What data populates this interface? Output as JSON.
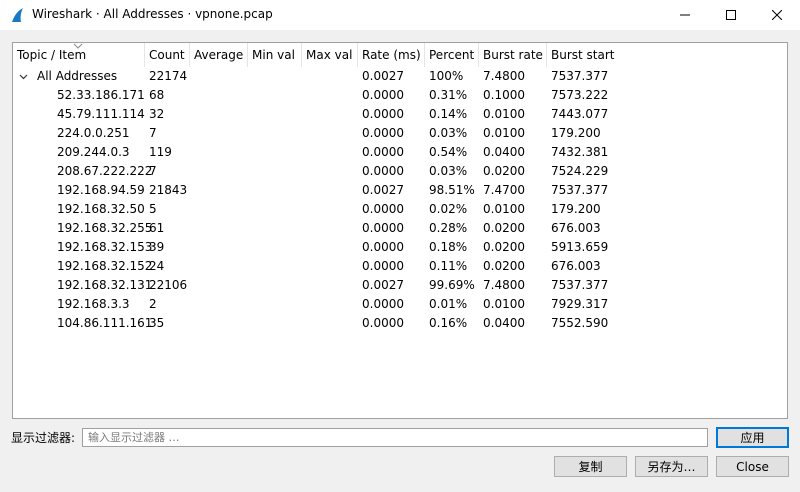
{
  "window": {
    "title": "Wireshark · All Addresses · vpnone.pcap"
  },
  "table": {
    "columns": [
      "Topic / Item",
      "Count",
      "Average",
      "Min val",
      "Max val",
      "Rate (ms)",
      "Percent",
      "Burst rate",
      "Burst start"
    ],
    "rows": [
      {
        "item": "All Addresses",
        "count": "22174",
        "average": "",
        "min": "",
        "max": "",
        "rate": "0.0027",
        "percent": "100%",
        "burst_rate": "7.4800",
        "burst_start": "7537.377",
        "expanded": true
      },
      {
        "item": "52.33.186.171",
        "count": "68",
        "average": "",
        "min": "",
        "max": "",
        "rate": "0.0000",
        "percent": "0.31%",
        "burst_rate": "0.1000",
        "burst_start": "7573.222"
      },
      {
        "item": "45.79.111.114",
        "count": "32",
        "average": "",
        "min": "",
        "max": "",
        "rate": "0.0000",
        "percent": "0.14%",
        "burst_rate": "0.0100",
        "burst_start": "7443.077"
      },
      {
        "item": "224.0.0.251",
        "count": "7",
        "average": "",
        "min": "",
        "max": "",
        "rate": "0.0000",
        "percent": "0.03%",
        "burst_rate": "0.0100",
        "burst_start": "179.200"
      },
      {
        "item": "209.244.0.3",
        "count": "119",
        "average": "",
        "min": "",
        "max": "",
        "rate": "0.0000",
        "percent": "0.54%",
        "burst_rate": "0.0400",
        "burst_start": "7432.381"
      },
      {
        "item": "208.67.222.222",
        "count": "7",
        "average": "",
        "min": "",
        "max": "",
        "rate": "0.0000",
        "percent": "0.03%",
        "burst_rate": "0.0200",
        "burst_start": "7524.229"
      },
      {
        "item": "192.168.94.59",
        "count": "21843",
        "average": "",
        "min": "",
        "max": "",
        "rate": "0.0027",
        "percent": "98.51%",
        "burst_rate": "7.4700",
        "burst_start": "7537.377"
      },
      {
        "item": "192.168.32.50",
        "count": "5",
        "average": "",
        "min": "",
        "max": "",
        "rate": "0.0000",
        "percent": "0.02%",
        "burst_rate": "0.0100",
        "burst_start": "179.200"
      },
      {
        "item": "192.168.32.255",
        "count": "61",
        "average": "",
        "min": "",
        "max": "",
        "rate": "0.0000",
        "percent": "0.28%",
        "burst_rate": "0.0200",
        "burst_start": "676.003"
      },
      {
        "item": "192.168.32.153",
        "count": "39",
        "average": "",
        "min": "",
        "max": "",
        "rate": "0.0000",
        "percent": "0.18%",
        "burst_rate": "0.0200",
        "burst_start": "5913.659"
      },
      {
        "item": "192.168.32.152",
        "count": "24",
        "average": "",
        "min": "",
        "max": "",
        "rate": "0.0000",
        "percent": "0.11%",
        "burst_rate": "0.0200",
        "burst_start": "676.003"
      },
      {
        "item": "192.168.32.131",
        "count": "22106",
        "average": "",
        "min": "",
        "max": "",
        "rate": "0.0027",
        "percent": "99.69%",
        "burst_rate": "7.4800",
        "burst_start": "7537.377"
      },
      {
        "item": "192.168.3.3",
        "count": "2",
        "average": "",
        "min": "",
        "max": "",
        "rate": "0.0000",
        "percent": "0.01%",
        "burst_rate": "0.0100",
        "burst_start": "7929.317"
      },
      {
        "item": "104.86.111.161",
        "count": "35",
        "average": "",
        "min": "",
        "max": "",
        "rate": "0.0000",
        "percent": "0.16%",
        "burst_rate": "0.0400",
        "burst_start": "7552.590"
      }
    ]
  },
  "filter": {
    "label": "显示过滤器:",
    "placeholder": "输入显示过滤器 …",
    "value": ""
  },
  "buttons": {
    "apply": "应用",
    "copy": "复制",
    "save_as": "另存为…",
    "close": "Close"
  },
  "icons": {
    "app": "wireshark-fin-icon",
    "minimize": "minimize-icon",
    "maximize": "maximize-icon",
    "close": "close-icon",
    "expander": "chevron-down-icon",
    "sort": "sort-indicator-icon"
  },
  "colors": {
    "accent": "#0078d7",
    "wireshark_blue": "#1679c5"
  }
}
